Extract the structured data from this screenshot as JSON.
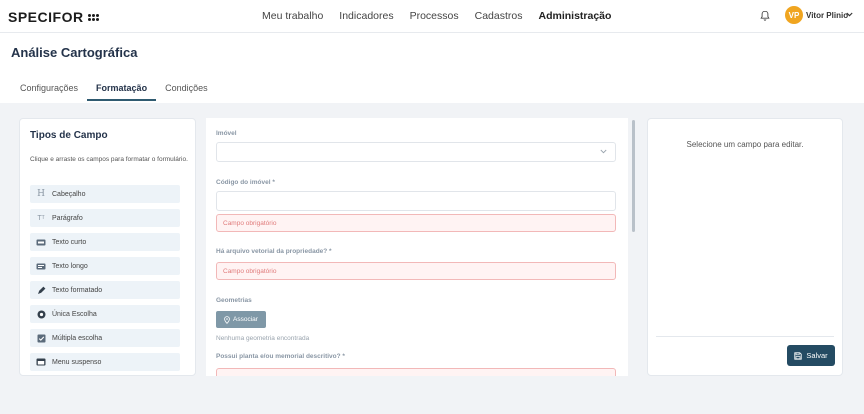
{
  "brand": {
    "name": "SPECIFOR"
  },
  "nav": {
    "items": [
      "Meu trabalho",
      "Indicadores",
      "Processos",
      "Cadastros",
      "Administração"
    ],
    "active": "Administração"
  },
  "user": {
    "initials": "VP",
    "name": "Vitor Plinio",
    "avatar_color": "#f0a520"
  },
  "page": {
    "title": "Análise Cartográfica",
    "tabs": [
      "Configurações",
      "Formatação",
      "Condições"
    ],
    "active_tab": "Formatação"
  },
  "field_types": {
    "title": "Tipos de Campo",
    "description": "Clique e arraste os campos para formatar o formulário.",
    "items": [
      {
        "label": "Cabeçalho",
        "icon": "heading-icon"
      },
      {
        "label": "Parágrafo",
        "icon": "paragraph-icon"
      },
      {
        "label": "Texto curto",
        "icon": "short-text-icon"
      },
      {
        "label": "Texto longo",
        "icon": "long-text-icon"
      },
      {
        "label": "Texto formatado",
        "icon": "pen-icon"
      },
      {
        "label": "Única Escolha",
        "icon": "radio-icon"
      },
      {
        "label": "Múltipla escolha",
        "icon": "checkbox-icon"
      },
      {
        "label": "Menu suspenso",
        "icon": "dropdown-menu-icon"
      }
    ]
  },
  "form": {
    "imovel": {
      "label": "Imóvel",
      "value": ""
    },
    "codigo": {
      "label": "Código do imóvel *",
      "value": "",
      "error": "Campo obrigatório"
    },
    "arquivo_vetorial": {
      "label": "Há arquivo vetorial da propriedade? *",
      "error": "Campo obrigatório"
    },
    "geometrias": {
      "label": "Geometrias",
      "button": "Associar",
      "empty": "Nenhuma geometria encontrada"
    },
    "planta": {
      "label": "Possui planta e/ou memorial descritivo? *"
    }
  },
  "editor": {
    "hint": "Selecione um campo para editar.",
    "save_label": "Salvar"
  },
  "colors": {
    "primary": "#244b63",
    "accent": "#f0a520",
    "error_bg": "#fff3f3",
    "error_text": "#e07b7b"
  }
}
